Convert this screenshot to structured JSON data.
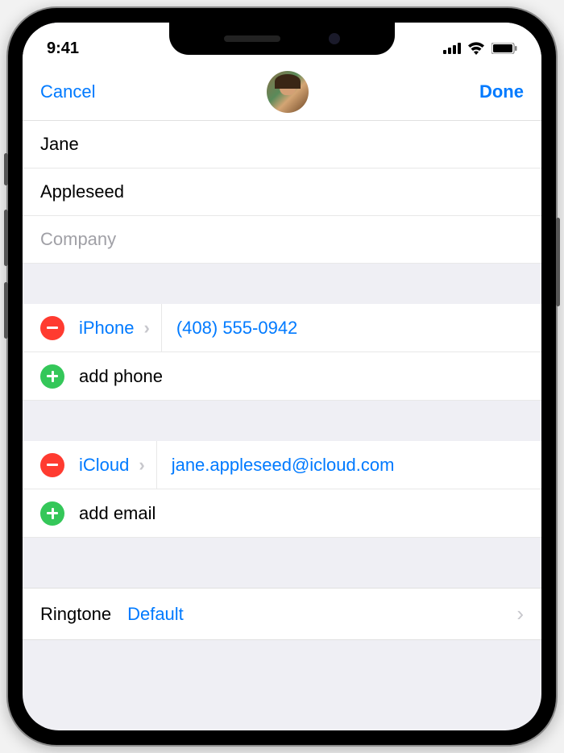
{
  "status": {
    "time": "9:41"
  },
  "nav": {
    "cancel": "Cancel",
    "done": "Done"
  },
  "contact": {
    "first_name": "Jane",
    "last_name": "Appleseed",
    "company_placeholder": "Company"
  },
  "phone": {
    "label": "iPhone",
    "value": "(408) 555-0942",
    "add_label": "add phone"
  },
  "email": {
    "label": "iCloud",
    "value": "jane.appleseed@icloud.com",
    "add_label": "add email"
  },
  "ringtone": {
    "label": "Ringtone",
    "value": "Default"
  }
}
